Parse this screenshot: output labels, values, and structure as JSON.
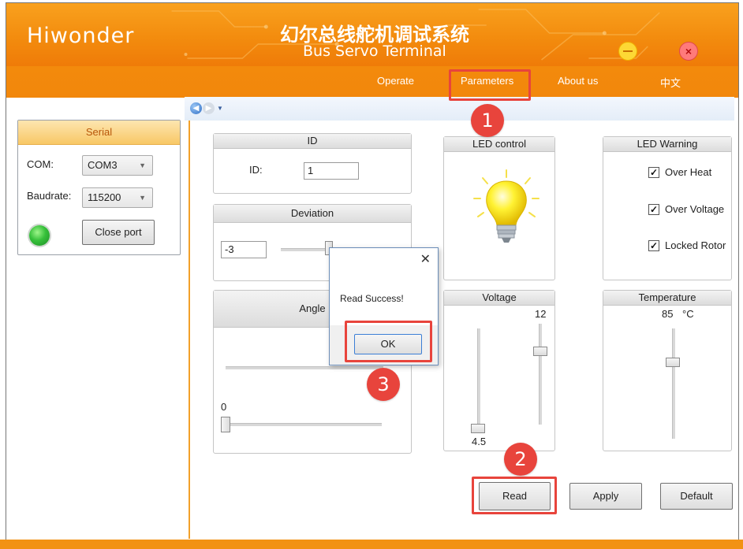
{
  "app": {
    "logo": "Hiwonder",
    "title_cn": "幻尔总线舵机调试系统",
    "title_en": "Bus Servo Terminal",
    "close_glyph": "×"
  },
  "menu": {
    "items": [
      "Operate",
      "Parameters",
      "About us",
      "中文"
    ]
  },
  "serial": {
    "title": "Serial",
    "com_label": "COM:",
    "com_value": "COM3",
    "baud_label": "Baudrate:",
    "baud_value": "115200",
    "close_port": "Close port",
    "status_color": "#36c03a"
  },
  "nav": {
    "back_glyph": "◀",
    "forward_glyph": "▶",
    "dropdown_glyph": "▼"
  },
  "id_group": {
    "title": "ID",
    "label": "ID:",
    "value": "1"
  },
  "deviation": {
    "title": "Deviation",
    "value": "-3"
  },
  "angle": {
    "title": "Angle",
    "value": "0"
  },
  "led_control": {
    "title": "LED control"
  },
  "led_warning": {
    "title": "LED Warning",
    "options": [
      {
        "label": "Over Heat",
        "checked": true
      },
      {
        "label": "Over Voltage",
        "checked": true
      },
      {
        "label": "Locked Rotor",
        "checked": true
      }
    ]
  },
  "voltage": {
    "title": "Voltage",
    "high_value": "12",
    "low_value": "4.5"
  },
  "temperature": {
    "title": "Temperature",
    "value": "85",
    "unit": "°C"
  },
  "dialog": {
    "close_glyph": "✕",
    "message": "Read Success!",
    "ok": "OK"
  },
  "actions": {
    "read": "Read",
    "apply": "Apply",
    "default": "Default"
  },
  "steps": [
    "1",
    "2",
    "3"
  ],
  "colors": {
    "accent_orange": "#f38c0e",
    "highlight_red": "#e8443c"
  }
}
